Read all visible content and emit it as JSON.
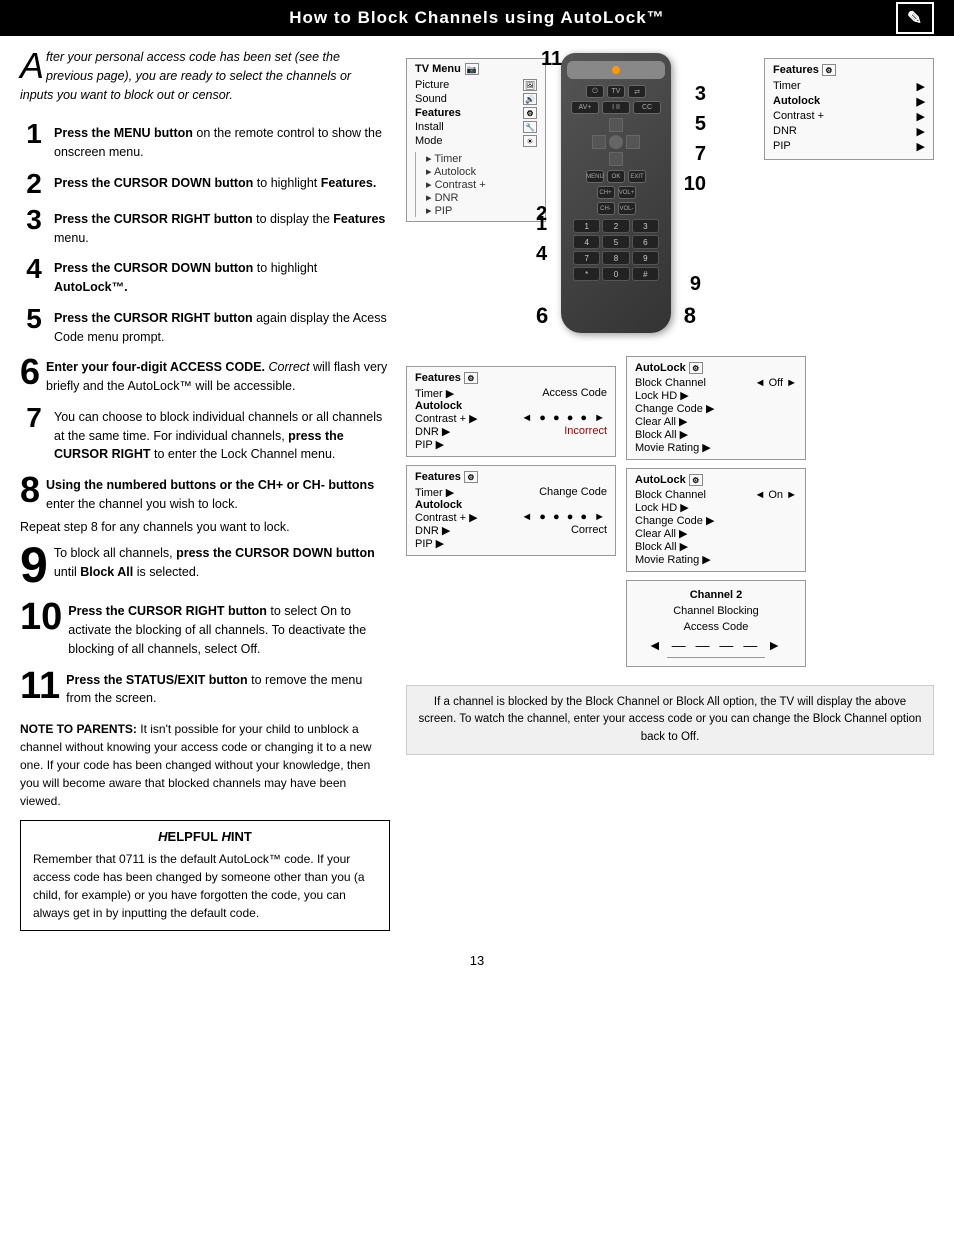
{
  "header": {
    "title": "How to Block Channels using AutoLock™",
    "icon": "📋"
  },
  "intro": {
    "drop_cap": "A",
    "text": "fter your personal access code has been set (see the previous page), you are ready to select the channels or inputs you want to block out or censor."
  },
  "steps": [
    {
      "num": "1",
      "size": "normal",
      "bold": "Press the MENU button",
      "rest": " on the remote control to show the onscreen menu."
    },
    {
      "num": "2",
      "size": "normal",
      "bold": "Press the CURSOR DOWN button",
      "rest": " to highlight ",
      "bold2": "Features."
    },
    {
      "num": "3",
      "size": "normal",
      "bold": "Press the CURSOR RIGHT button",
      "rest": " to display the ",
      "bold2": "Features",
      "rest2": " menu."
    },
    {
      "num": "4",
      "size": "normal",
      "bold": "Press the CURSOR DOWN button",
      "rest": " to highlight ",
      "bold2": "AutoLock™."
    },
    {
      "num": "5",
      "size": "normal",
      "bold": "Press the CURSOR RIGHT button",
      "rest": " again display the Acess Code menu prompt."
    },
    {
      "num": "6",
      "size": "large",
      "bold": "Enter your four-digit ACCESS CODE.",
      "italic": " Correct",
      "rest": " will flash very briefly and the AutoLock™ will be accessible."
    },
    {
      "num": "7",
      "size": "normal",
      "rest_prefix": "You can choose to block individual channels or all channels at the same time. For individual channels, ",
      "bold": "press the CURSOR RIGHT",
      "rest": " to enter the Lock Channel menu."
    },
    {
      "num": "8",
      "size": "large",
      "bold": "Using the numbered buttons or the CH+ or CH- buttons",
      "rest": " enter the channel you wish to lock."
    }
  ],
  "repeat_note": "Repeat step 8 for any channels you want to lock.",
  "steps_continued": [
    {
      "num": "9",
      "size": "large",
      "rest_prefix": "To block all channels, ",
      "bold": "press the CURSOR DOWN button",
      "rest": " until ",
      "bold2": "Block All",
      "rest2": " is selected."
    },
    {
      "num": "10",
      "size": "large",
      "bold": "Press the CURSOR RIGHT button",
      "rest": " to select On to activate the blocking of all channels. To deactivate the blocking of all channels, select Off."
    },
    {
      "num": "11",
      "size": "large",
      "bold": "Press the STATUS/EXIT button",
      "rest": " to remove the menu from the screen."
    }
  ],
  "note": {
    "label": "NOTE TO PARENTS:",
    "text": " It isn't possible for your child to unblock a channel without knowing your access code or changing it to a new one. If your code has been changed without your knowledge, then you will become aware that blocked channels may have been viewed."
  },
  "hint": {
    "title": "Helpful Hint",
    "text": "Remember that 0711 is the default AutoLock™ code.  If your access code has been changed by someone other than you (a child, for example) or you have forgotten the code, you can always get in by inputting the default code."
  },
  "page_num": "13",
  "tv_menu": {
    "title": "TV Menu",
    "items": [
      {
        "label": "Picture",
        "sub": ""
      },
      {
        "label": "Sound",
        "sub": ""
      },
      {
        "label": "Features",
        "sub": "",
        "highlighted": true
      },
      {
        "label": "Install",
        "sub": ""
      },
      {
        "label": "Mode",
        "sub": ""
      }
    ],
    "sub_items": [
      "Timer",
      "Autolock",
      "Contrast +",
      "DNR",
      "PIP"
    ]
  },
  "panels": [
    {
      "id": "panel1",
      "title": "Features",
      "rows": [
        {
          "label": "Timer",
          "value": "▶",
          "bold": false
        },
        {
          "label": "Autolock",
          "value": "",
          "bold": true
        },
        {
          "label": "Contrast +",
          "value": "▶",
          "bold": false
        },
        {
          "label": "DNR",
          "value": "▶",
          "bold": false
        },
        {
          "label": "PIP",
          "value": "▶",
          "bold": false
        }
      ],
      "extra": null
    },
    {
      "id": "panel2",
      "title": "Features",
      "rows": [
        {
          "label": "Timer",
          "value": "▶",
          "bold": false,
          "right_label": "Access Code"
        },
        {
          "label": "Autolock",
          "value": "",
          "bold": true
        },
        {
          "label": "Contrast +",
          "value": "▶",
          "bold": false,
          "right_label": "● ● ● ●"
        },
        {
          "label": "DNR",
          "value": "▶",
          "bold": false,
          "right_label": "Incorrect"
        },
        {
          "label": "PIP",
          "value": "▶",
          "bold": false
        }
      ]
    },
    {
      "id": "panel3",
      "title": "Features",
      "rows": [
        {
          "label": "Timer",
          "value": "▶",
          "bold": false,
          "right_label": "Change Code"
        },
        {
          "label": "Autolock",
          "value": "",
          "bold": true
        },
        {
          "label": "Contrast +",
          "value": "▶",
          "bold": false,
          "right_label": "● ● ● ●"
        },
        {
          "label": "DNR",
          "value": "▶",
          "bold": false,
          "right_label": "Correct"
        },
        {
          "label": "PIP",
          "value": "▶",
          "bold": false
        }
      ]
    },
    {
      "id": "panel4",
      "title": "AutoLock",
      "rows": [
        {
          "label": "Block Channel",
          "value": "◄ Off ►",
          "bold": false
        },
        {
          "label": "Lock HD",
          "value": "▶",
          "bold": false
        },
        {
          "label": "Change Code",
          "value": "▶",
          "bold": false
        },
        {
          "label": "Clear All",
          "value": "▶",
          "bold": false
        },
        {
          "label": "Block All",
          "value": "▶",
          "bold": false
        },
        {
          "label": "Movie Rating",
          "value": "▶",
          "bold": false
        }
      ]
    },
    {
      "id": "panel5",
      "title": "AutoLock",
      "rows": [
        {
          "label": "Block Channel",
          "value": "◄ On ►",
          "bold": false
        },
        {
          "label": "Lock HD",
          "value": "▶",
          "bold": false
        },
        {
          "label": "Change Code",
          "value": "▶",
          "bold": false
        },
        {
          "label": "Clear All",
          "value": "▶",
          "bold": false
        },
        {
          "label": "Block All",
          "value": "▶",
          "bold": false
        },
        {
          "label": "Movie Rating",
          "value": "▶",
          "bold": false
        }
      ]
    }
  ],
  "channel_panel": {
    "title": "Channel 2",
    "subtitle": "Channel Blocking",
    "label": "Access Code",
    "dots": "◄ — — — — ►"
  },
  "bottom_desc": "If a channel is blocked by the Block Channel or Block All option, the TV will display the above screen. To watch the channel, enter your access code or you can change the Block Channel option back to Off.",
  "remote": {
    "callouts": [
      "11",
      "3",
      "5",
      "7",
      "10",
      "2",
      "4",
      "9",
      "1",
      "6",
      "8"
    ],
    "numpad": [
      "1",
      "2",
      "3",
      "4",
      "5",
      "6",
      "7",
      "8",
      "9",
      "⓪",
      "0",
      "—"
    ]
  }
}
